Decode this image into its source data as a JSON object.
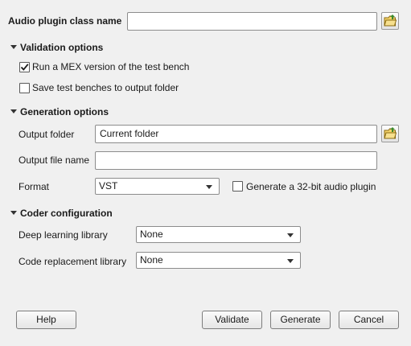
{
  "plugin_class": {
    "label": "Audio plugin class name",
    "value": "",
    "browse_icon": "folder-open-icon"
  },
  "validation": {
    "heading": "Validation options",
    "run_mex": {
      "label": "Run a MEX version of the test bench",
      "checked": true
    },
    "save_benches": {
      "label": "Save test benches to output folder",
      "checked": false
    }
  },
  "generation": {
    "heading": "Generation options",
    "output_folder": {
      "label": "Output folder",
      "value": "Current folder",
      "browse_icon": "folder-open-icon"
    },
    "output_file": {
      "label": "Output file name",
      "value": ""
    },
    "format": {
      "label": "Format",
      "value": "VST"
    },
    "gen32": {
      "label": "Generate a 32-bit audio plugin",
      "checked": false
    }
  },
  "coder": {
    "heading": "Coder configuration",
    "deep_learning": {
      "label": "Deep learning library",
      "value": "None"
    },
    "code_replacement": {
      "label": "Code replacement library",
      "value": "None"
    }
  },
  "buttons": {
    "help": "Help",
    "validate": "Validate",
    "generate": "Generate",
    "cancel": "Cancel"
  },
  "colors": {
    "background": "#f0f0f0",
    "folder_icon": "#3a8a2a"
  }
}
